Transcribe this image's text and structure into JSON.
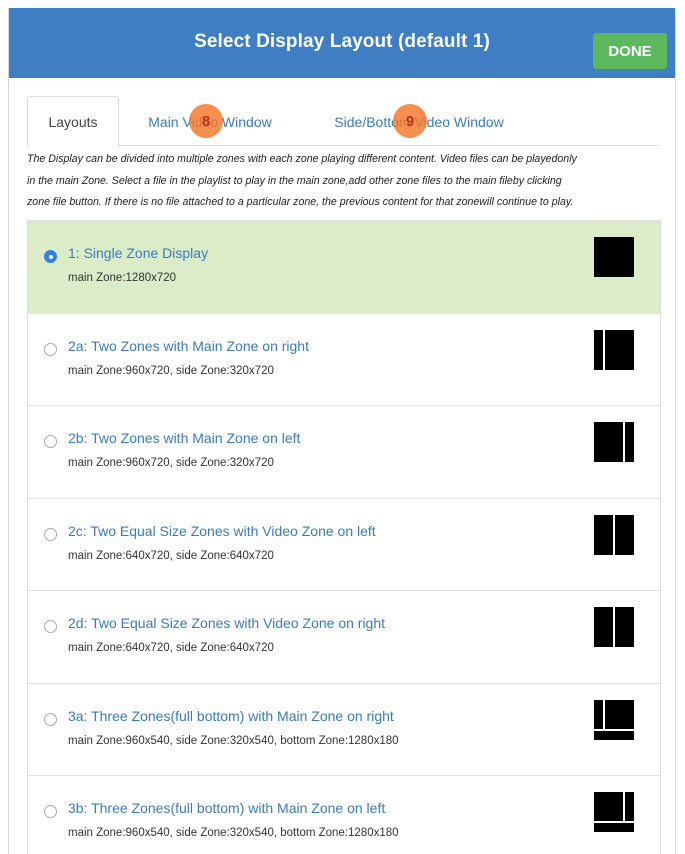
{
  "header": {
    "title": "Select Display Layout (default 1)",
    "done_label": "DONE"
  },
  "tabs": [
    {
      "label": "Layouts",
      "active": true
    },
    {
      "label": "Main Video Window",
      "active": false
    },
    {
      "label": "Side/Bottom Video Window",
      "active": false
    }
  ],
  "badges": [
    "8",
    "9"
  ],
  "description": {
    "line1": "The Display can be divided into multiple zones with each zone playing different content. Video files can be playedonly",
    "line2": "in the main Zone. Select a file in the playlist to play in the main zone,add other zone files to the main fileby clicking",
    "line3": "zone file button. If there is no file attached to a particular zone, the previous content for that zonewill continue to play."
  },
  "layouts": [
    {
      "title": "1:  Single Zone Display",
      "sub": "main Zone:1280x720",
      "selected": true,
      "icon": "single-zone-icon"
    },
    {
      "title": "2a:  Two Zones with Main Zone on right",
      "sub": "main Zone:960x720, side Zone:320x720",
      "selected": false,
      "icon": "two-zone-main-right-icon"
    },
    {
      "title": "2b:  Two Zones with Main Zone on left",
      "sub": "main Zone:960x720, side Zone:320x720",
      "selected": false,
      "icon": "two-zone-main-left-icon"
    },
    {
      "title": "2c:  Two Equal Size Zones with Video Zone on left",
      "sub": "main Zone:640x720, side Zone:640x720",
      "selected": false,
      "icon": "two-equal-zones-icon"
    },
    {
      "title": "2d:  Two Equal Size Zones with Video Zone on right",
      "sub": "main Zone:640x720, side Zone:640x720",
      "selected": false,
      "icon": "two-equal-zones-icon"
    },
    {
      "title": "3a:  Three Zones(full bottom) with Main Zone on right",
      "sub": "main Zone:960x540, side Zone:320x540, bottom Zone:1280x180",
      "selected": false,
      "icon": "three-zone-main-right-icon"
    },
    {
      "title": "3b:  Three Zones(full bottom) with Main Zone on left",
      "sub": "main Zone:960x540, side Zone:320x540, bottom Zone:1280x180",
      "selected": false,
      "icon": "three-zone-main-left-icon"
    }
  ],
  "colors": {
    "header": "#3f7ec3",
    "done": "#5cb85c",
    "selected_row": "#dbecc9",
    "link": "#3a7bbf",
    "badge": "#f4762a"
  }
}
